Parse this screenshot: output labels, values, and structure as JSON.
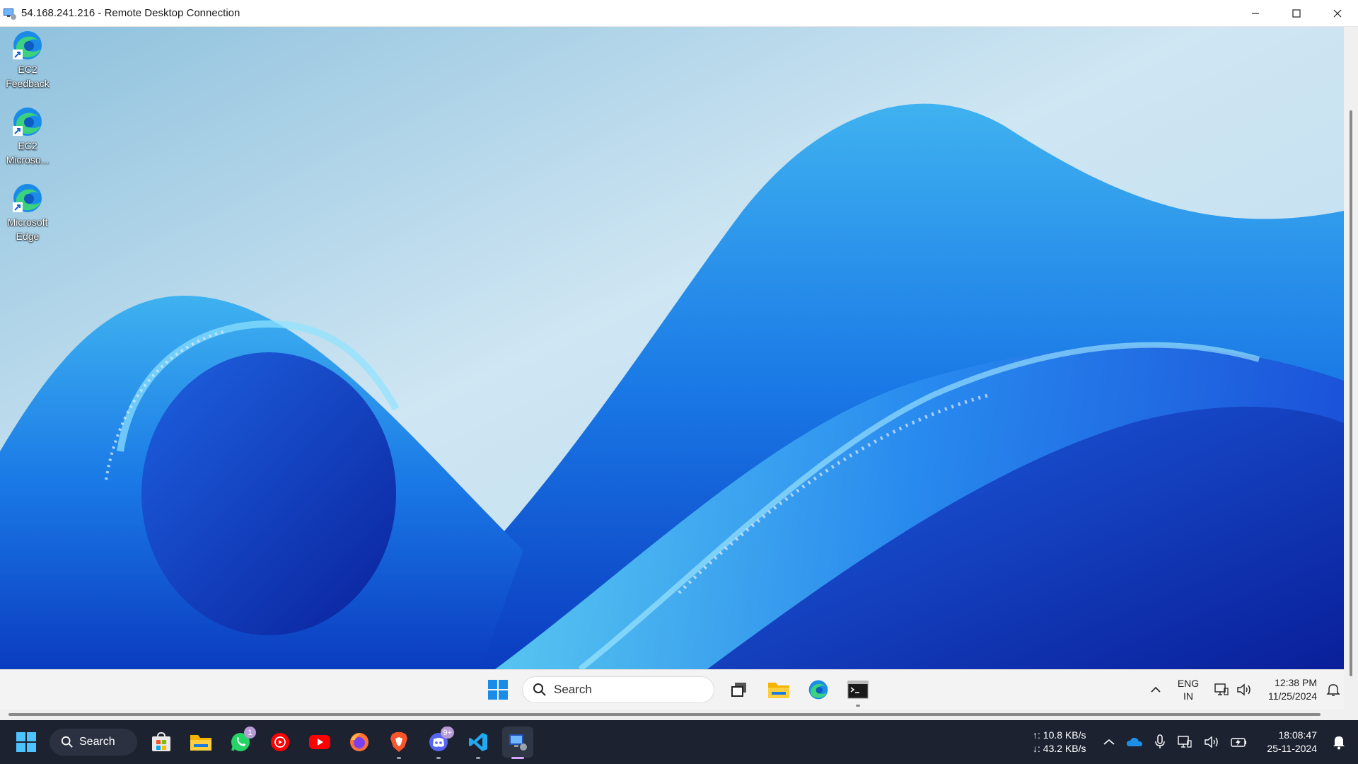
{
  "window": {
    "title": "54.168.241.216 - Remote Desktop Connection",
    "controls": [
      "minimize-icon",
      "maximize-icon",
      "close-icon"
    ]
  },
  "desktop": {
    "icons": [
      {
        "label": "EC2 Feedback",
        "icon": "edge-icon"
      },
      {
        "label": "EC2 Microso...",
        "icon": "edge-icon"
      },
      {
        "label": "Microsoft Edge",
        "icon": "edge-icon"
      }
    ]
  },
  "remote_taskbar": {
    "search_placeholder": "Search",
    "apps": [
      "task-view-icon",
      "file-explorer-icon",
      "edge-icon",
      "command-prompt-icon"
    ],
    "tray": {
      "lang_line1": "ENG",
      "lang_line2": "IN",
      "time": "12:38 PM",
      "date": "11/25/2024"
    }
  },
  "host_taskbar": {
    "search_label": "Search",
    "apps": [
      {
        "icon": "microsoft-store-icon"
      },
      {
        "icon": "file-explorer-icon"
      },
      {
        "icon": "whatsapp-icon",
        "badge": "1"
      },
      {
        "icon": "youtube-music-icon"
      },
      {
        "icon": "youtube-icon"
      },
      {
        "icon": "firefox-icon"
      },
      {
        "icon": "brave-icon"
      },
      {
        "icon": "discord-icon",
        "badge": "9+"
      },
      {
        "icon": "vscode-icon"
      },
      {
        "icon": "remote-desktop-icon",
        "active": true
      }
    ],
    "network": {
      "upload": "↑: 10.8 KB/s",
      "download": "↓: 43.2 KB/s"
    },
    "time": "18:08:47",
    "date": "25-11-2024"
  },
  "colors": {
    "host_taskbar_bg": "#1c2230",
    "remote_taskbar_bg": "#f3f3f3",
    "wallpaper_accent": "#1466e8"
  }
}
